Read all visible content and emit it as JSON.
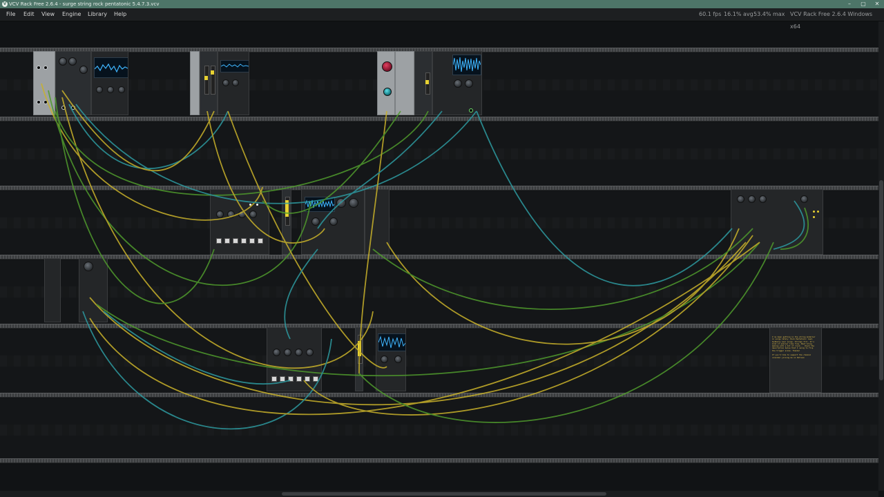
{
  "window": {
    "title": "VCV Rack Free 2.6.4 - surge string rock pentatonic 5.4.7.3.vcv",
    "icon": "vcv-rack-icon",
    "controls": [
      "–",
      "▢",
      "✕"
    ]
  },
  "menubar": {
    "items": [
      "File",
      "Edit",
      "View",
      "Engine",
      "Library",
      "Help"
    ],
    "fps": "60.1 fps",
    "avg": "16.1% avg",
    "max": "53.4% max",
    "version": "VCV Rack Free 2.6.4 Windows x64"
  },
  "notes": {
    "text": "I've been getting in the string modeller in surge lately. Rock Pentatonic lead. Suddenly ever surge. Strings fill. It's kind of similar like fine..Best bring making with a bit of clock... Check the description below that I using to flip the trigger scale. Thanks!\n\nIf you'd like to support the channel consider joining me on Patreon"
  },
  "colors": {
    "cable_yellow": "#c9b22a",
    "cable_green": "#4f9a2c",
    "cable_teal": "#2d9aa0",
    "scope_wave": "#3fb6ff",
    "accent_yellow": "#e8d232"
  }
}
